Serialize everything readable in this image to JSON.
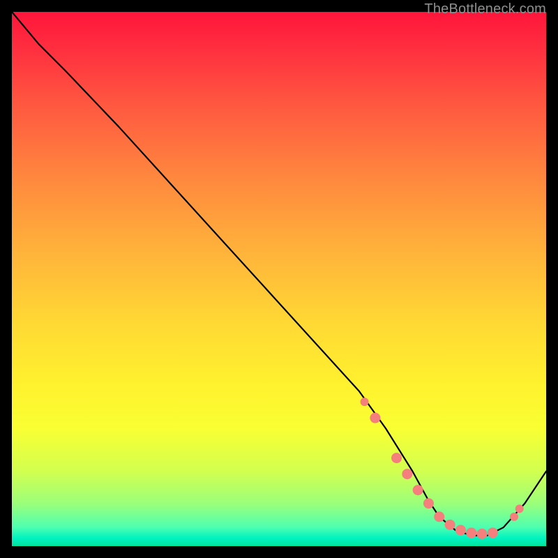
{
  "watermark": "TheBottleneck.com",
  "chart_data": {
    "type": "line",
    "title": "",
    "xlabel": "",
    "ylabel": "",
    "xlim": [
      0,
      100
    ],
    "ylim": [
      0,
      100
    ],
    "series": [
      {
        "name": "curve",
        "type": "line",
        "x": [
          0,
          5,
          10,
          20,
          30,
          40,
          50,
          60,
          65,
          70,
          75,
          78,
          80,
          83,
          86,
          89,
          92,
          96,
          100
        ],
        "y": [
          100,
          94,
          89,
          78.5,
          67.5,
          56.5,
          45.5,
          34.5,
          29,
          22,
          14,
          8.5,
          5.5,
          3,
          2,
          2,
          3.5,
          8,
          14
        ]
      },
      {
        "name": "markers",
        "type": "scatter",
        "x": [
          66,
          68,
          72,
          74,
          76,
          78,
          80,
          82,
          84,
          86,
          88,
          90,
          94,
          95
        ],
        "y": [
          27,
          24,
          16.5,
          13.5,
          10.5,
          8,
          5.5,
          4,
          3,
          2.5,
          2.3,
          2.5,
          5.5,
          7
        ]
      }
    ],
    "colors": {
      "line": "#000000",
      "marker_fill": "#f57f7c",
      "marker_stroke": "#f57f7c"
    }
  }
}
